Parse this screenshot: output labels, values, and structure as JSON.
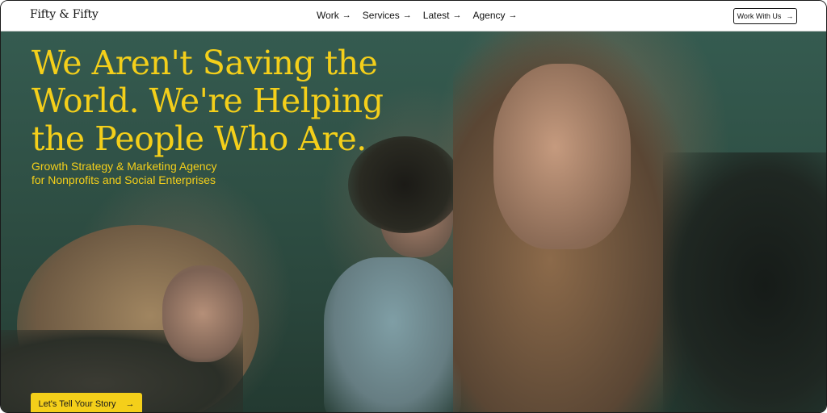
{
  "header": {
    "logo": {
      "first": "Fifty",
      "amp": "&",
      "second": "Fifty"
    },
    "nav": [
      {
        "label": "Work",
        "arrow": "→"
      },
      {
        "label": "Services",
        "arrow": "→"
      },
      {
        "label": "Latest",
        "arrow": "→"
      },
      {
        "label": "Agency",
        "arrow": "→"
      }
    ],
    "cta": {
      "label": "Work With Us",
      "arrow": "→"
    }
  },
  "hero": {
    "headline_lines": [
      "We Aren't Saving the",
      "World. We're Helping",
      "the People Who Are."
    ],
    "subheadline_lines": [
      "Growth Strategy & Marketing Agency",
      "for Nonprofits and Social Enterprises"
    ],
    "cta": {
      "label": "Let's Tell Your Story",
      "arrow": "→"
    },
    "accent_color": "#f4cf1a",
    "overlay_color": "#2f5045"
  }
}
